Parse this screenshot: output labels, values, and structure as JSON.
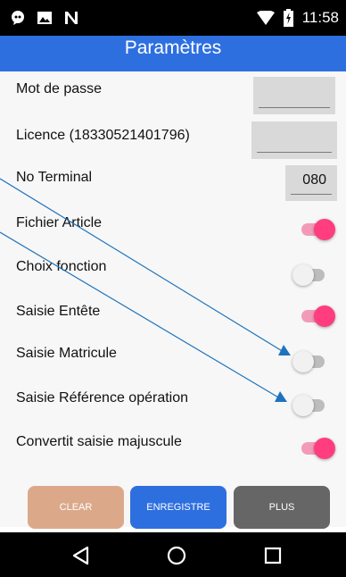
{
  "status_bar": {
    "time": "11:58",
    "left_icons": [
      "message-icon",
      "image-icon",
      "n-logo-icon"
    ],
    "right_icons": [
      "wifi-icon",
      "battery-icon"
    ]
  },
  "header": {
    "title": "Paramètres"
  },
  "settings": {
    "password_label": "Mot de passe",
    "password_value": "",
    "license_label": "Licence (18330521401796)",
    "license_value": "",
    "terminal_label": "No Terminal",
    "terminal_value": "080",
    "toggles": [
      {
        "label": "Fichier Article",
        "on": true
      },
      {
        "label": "Choix fonction",
        "on": false
      },
      {
        "label": "Saisie Entête",
        "on": true
      },
      {
        "label": "Saisie Matricule",
        "on": false
      },
      {
        "label": "Saisie Référence opération",
        "on": false
      },
      {
        "label": "Convertit saisie majuscule",
        "on": true
      }
    ]
  },
  "buttons": {
    "clear_label": "CLEAR",
    "save_label": "ENREGISTRE",
    "more_label": "PLUS"
  },
  "nav": {
    "icons": [
      "back-icon",
      "home-icon",
      "recents-icon"
    ]
  },
  "colors": {
    "header": "#2e6fe0",
    "clear": "#dba98a",
    "save": "#2e6fe0",
    "more": "#666666",
    "toggle_on": "#ff3d7f",
    "annotation": "#1e73be"
  }
}
